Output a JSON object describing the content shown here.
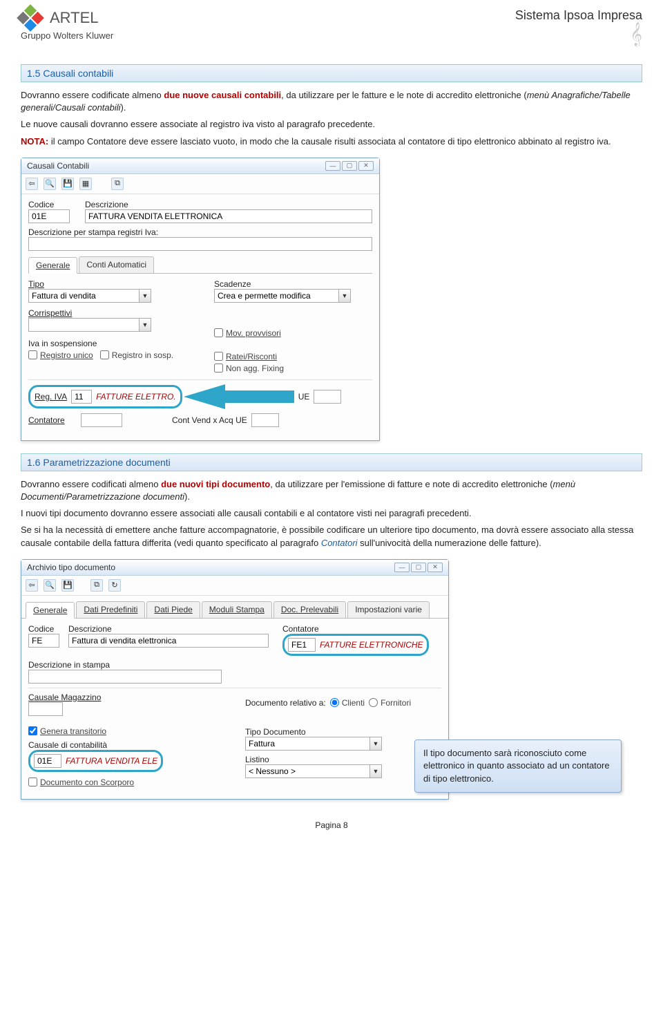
{
  "header": {
    "brand": "ARTEL",
    "subtitle": "Gruppo Wolters Kluwer",
    "right_title": "Sistema Ipsoa Impresa"
  },
  "section15": {
    "title": "1.5   Causali contabili",
    "p1a": "Dovranno essere codificate almeno ",
    "p1b": "due nuove causali contabili",
    "p1c": ", da utilizzare per le fatture e le note di accredito elettroniche (",
    "p1d": "menù Anagrafiche/Tabelle generali/Causali contabili",
    "p1e": ").",
    "p2": "Le nuove causali dovranno essere associate al registro iva visto al paragrafo precedente.",
    "nota_lbl": "NOTA:",
    "p3": " il campo Contatore deve essere lasciato vuoto, in modo che la causale risulti associata al contatore di tipo elettronico abbinato al registro iva."
  },
  "win1": {
    "title": "Causali Contabili",
    "codice_lbl": "Codice",
    "descr_lbl": "Descrizione",
    "codice_val": "01E",
    "descr_val": "FATTURA VENDITA ELETTRONICA",
    "descr2_lbl": "Descrizione per stampa registri Iva:",
    "tab_generale": "Generale",
    "tab_conti": "Conti Automatici",
    "tipo_lbl": "Tipo",
    "tipo_val": "Fattura di vendita",
    "scadenze_lbl": "Scadenze",
    "scadenze_val": "Crea e permette modifica",
    "corr_lbl": "Corrispettivi",
    "mov_prov": "Mov. provvisori",
    "iva_susp": "Iva in sospensione",
    "reg_unico": "Registro unico",
    "reg_sosp": "Registro in sosp.",
    "ratei": "Ratei/Risconti",
    "nonagg": "Non agg. Fixing",
    "regiva_lbl": "Reg. IVA",
    "regiva_num": "11",
    "regiva_desc": "FATTURE ELETTRO.",
    "ue_lbl": "UE",
    "contatore_lbl": "Contatore",
    "contvend": "Cont Vend x Acq UE"
  },
  "section16": {
    "title": "1.6   Parametrizzazione documenti",
    "p1a": "Dovranno essere codificati almeno ",
    "p1b": "due nuovi tipi documento",
    "p1c": ", da utilizzare per l'emissione di fatture e note di accredito elettroniche (",
    "p1d": "menù Documenti/Parametrizzazione documenti",
    "p1e": ").",
    "p2": "I nuovi tipi documento dovranno essere associati alle causali contabili e al contatore visti nei paragrafi precedenti.",
    "p3a": "Se si ha la necessità di emettere anche fatture accompagnatorie, è possibile codificare un ulteriore tipo documento, ma dovrà essere associato alla stessa causale contabile della fattura differita (vedi quanto specificato al paragrafo ",
    "p3b": "Contatori",
    "p3c": " sull'univocità della numerazione delle fatture)."
  },
  "win2": {
    "title": "Archivio tipo documento",
    "tab_gen": "Generale",
    "tab_dp": "Dati Predefiniti",
    "tab_dpie": "Dati Piede",
    "tab_ms": "Moduli Stampa",
    "tab_dpr": "Doc. Prelevabili",
    "tab_iv": "Impostazioni varie",
    "codice_lbl": "Codice",
    "descr_lbl": "Descrizione",
    "codice_val": "FE",
    "descr_val": "Fattura di vendita elettronica",
    "cont_lbl": "Contatore",
    "cont_code": "FE1",
    "cont_desc": "FATTURE ELETTRONICHE",
    "descr_stampa_lbl": "Descrizione in stampa",
    "causmag_lbl": "Causale Magazzino",
    "docrel_lbl": "Documento relativo a:",
    "clienti": "Clienti",
    "fornitori": "Fornitori",
    "gentrans": "Genera transitorio",
    "tipodoc_lbl": "Tipo Documento",
    "tipodoc_val": "Fattura",
    "causcont_lbl": "Causale di contabilità",
    "causcont_code": "01E",
    "causcont_desc": "FATTURA VENDITA ELE",
    "listino_lbl": "Listino",
    "listino_val": "< Nessuno >",
    "docscorporo": "Documento con Scorporo"
  },
  "callout": "Il tipo documento sarà riconosciuto come elettronico in quanto associato ad un contatore di tipo elettronico.",
  "footer": "Pagina 8"
}
